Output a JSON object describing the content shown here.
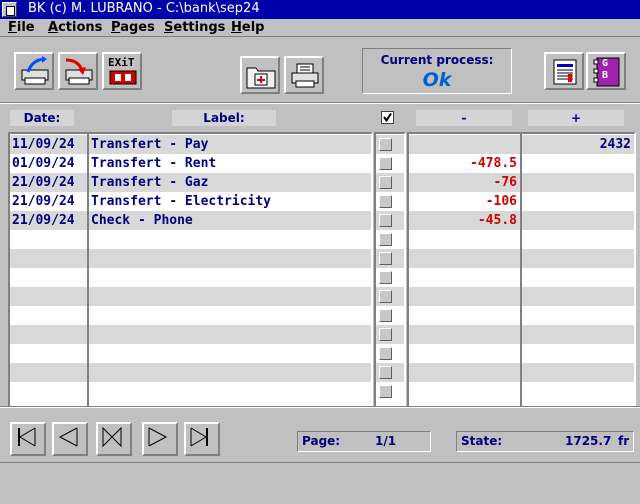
{
  "window": {
    "title": "BK (c) M. LUBRANO - C:\\bank\\sep24"
  },
  "menu": [
    {
      "label": "File",
      "ul": "F",
      "rest": "ile"
    },
    {
      "label": "Actions",
      "ul": "A",
      "rest": "ctions"
    },
    {
      "label": "Pages",
      "ul": "P",
      "rest": "ages"
    },
    {
      "label": "Settings",
      "ul": "S",
      "rest": "ettings"
    },
    {
      "label": "Help",
      "ul": "H",
      "rest": "elp"
    }
  ],
  "toolbar": {
    "exit_label": "EXiT",
    "address_book_label": "G B"
  },
  "process": {
    "label": "Current process:",
    "value": "Ok"
  },
  "headers": {
    "date": "Date:",
    "label": "Label:",
    "minus": "-",
    "plus": "+"
  },
  "transactions": [
    {
      "date": "11/09/24",
      "label": "Transfert - Pay",
      "minus": "",
      "plus": "2432"
    },
    {
      "date": "01/09/24",
      "label": "Transfert - Rent",
      "minus": "-478.5",
      "plus": ""
    },
    {
      "date": "21/09/24",
      "label": "Transfert - Gaz",
      "minus": "-76",
      "plus": ""
    },
    {
      "date": "21/09/24",
      "label": "Transfert - Electricity",
      "minus": "-106",
      "plus": ""
    },
    {
      "date": "21/09/24",
      "label": "Check - Phone",
      "minus": "-45.8",
      "plus": ""
    }
  ],
  "total_rows": 14,
  "footer": {
    "page_label": "Page:",
    "page_value": "1/1",
    "state_label": "State:",
    "state_value": "1725.7",
    "state_unit": "fr"
  },
  "colors": {
    "titlebar": "#0000a8",
    "debit": "#d00000",
    "text": "#000080"
  }
}
